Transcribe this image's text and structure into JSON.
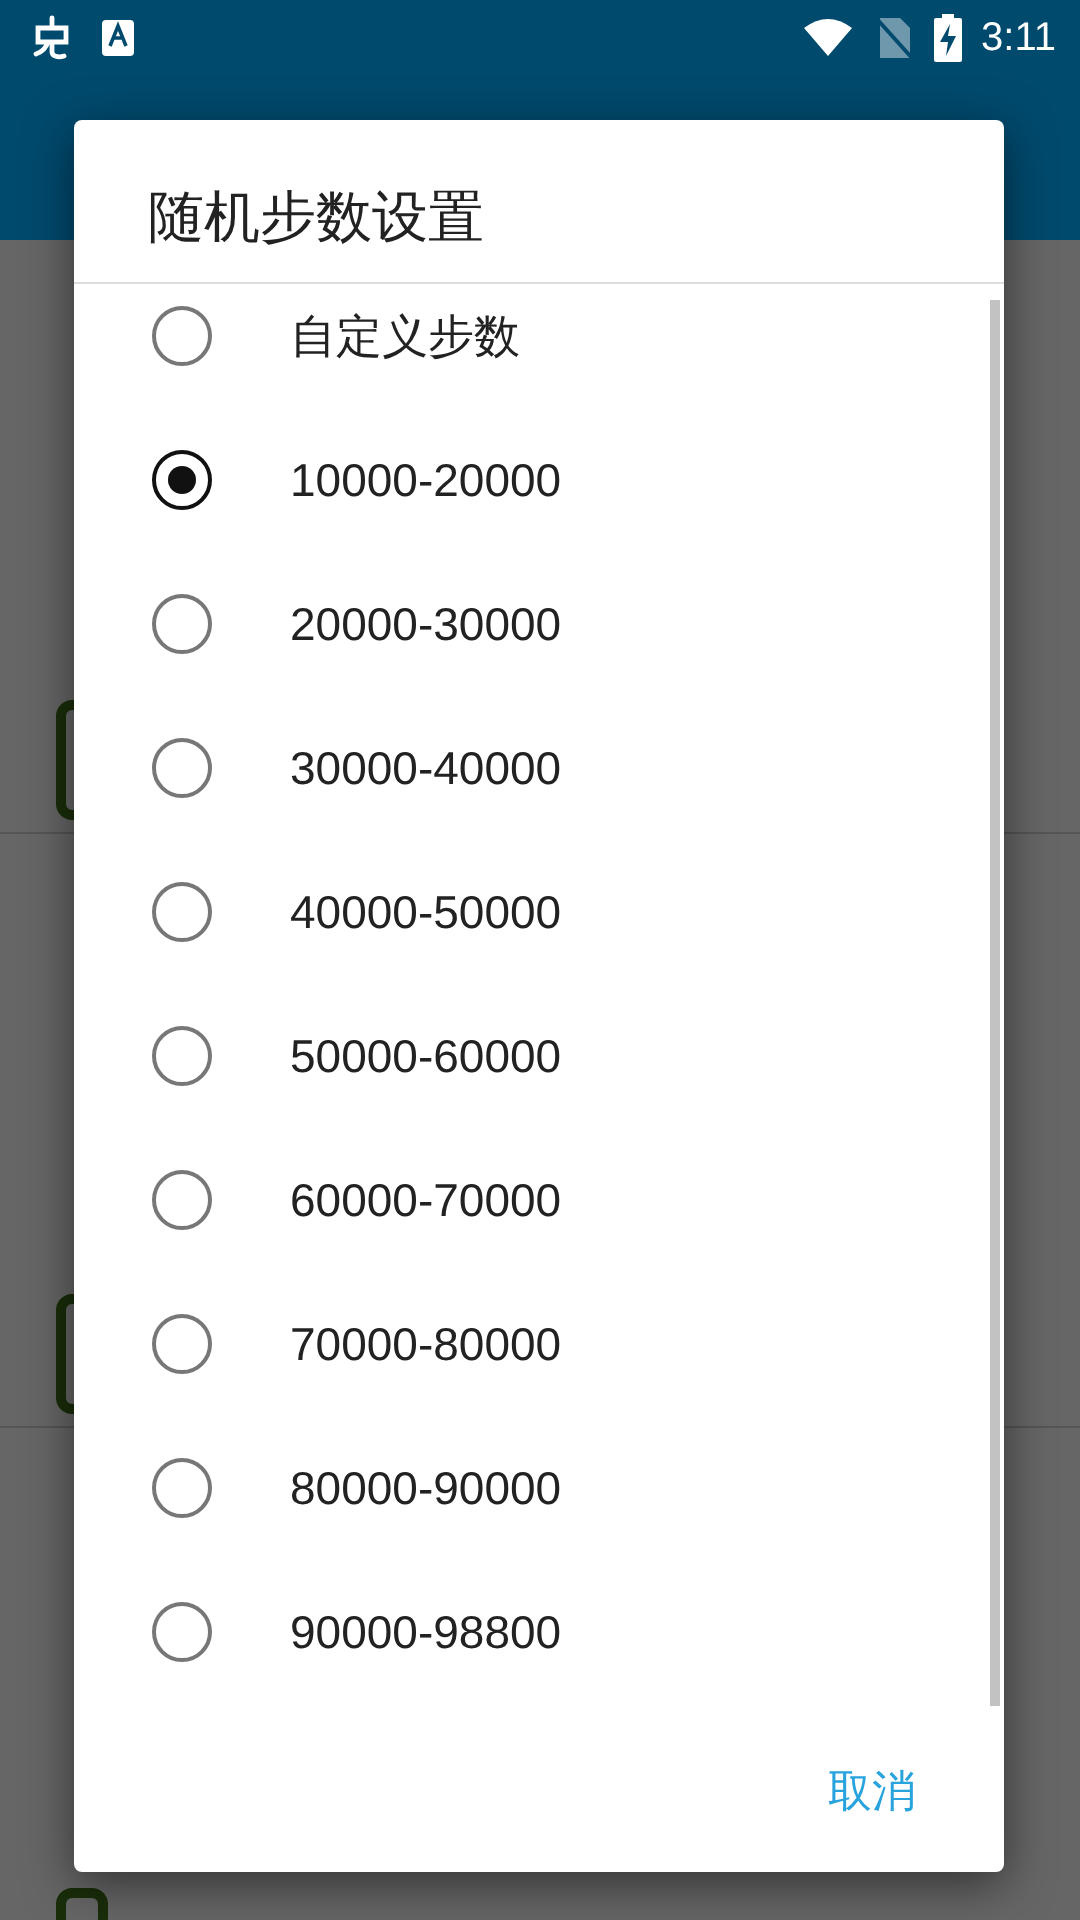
{
  "status_bar": {
    "time": "3:11"
  },
  "dialog": {
    "title": "随机步数设置",
    "options": [
      {
        "label": "自定义步数",
        "selected": false
      },
      {
        "label": "10000-20000",
        "selected": true
      },
      {
        "label": "20000-30000",
        "selected": false
      },
      {
        "label": "30000-40000",
        "selected": false
      },
      {
        "label": "40000-50000",
        "selected": false
      },
      {
        "label": "50000-60000",
        "selected": false
      },
      {
        "label": "60000-70000",
        "selected": false
      },
      {
        "label": "70000-80000",
        "selected": false
      },
      {
        "label": "80000-90000",
        "selected": false
      },
      {
        "label": "90000-98800",
        "selected": false
      }
    ],
    "buttons": [
      "取消"
    ]
  }
}
